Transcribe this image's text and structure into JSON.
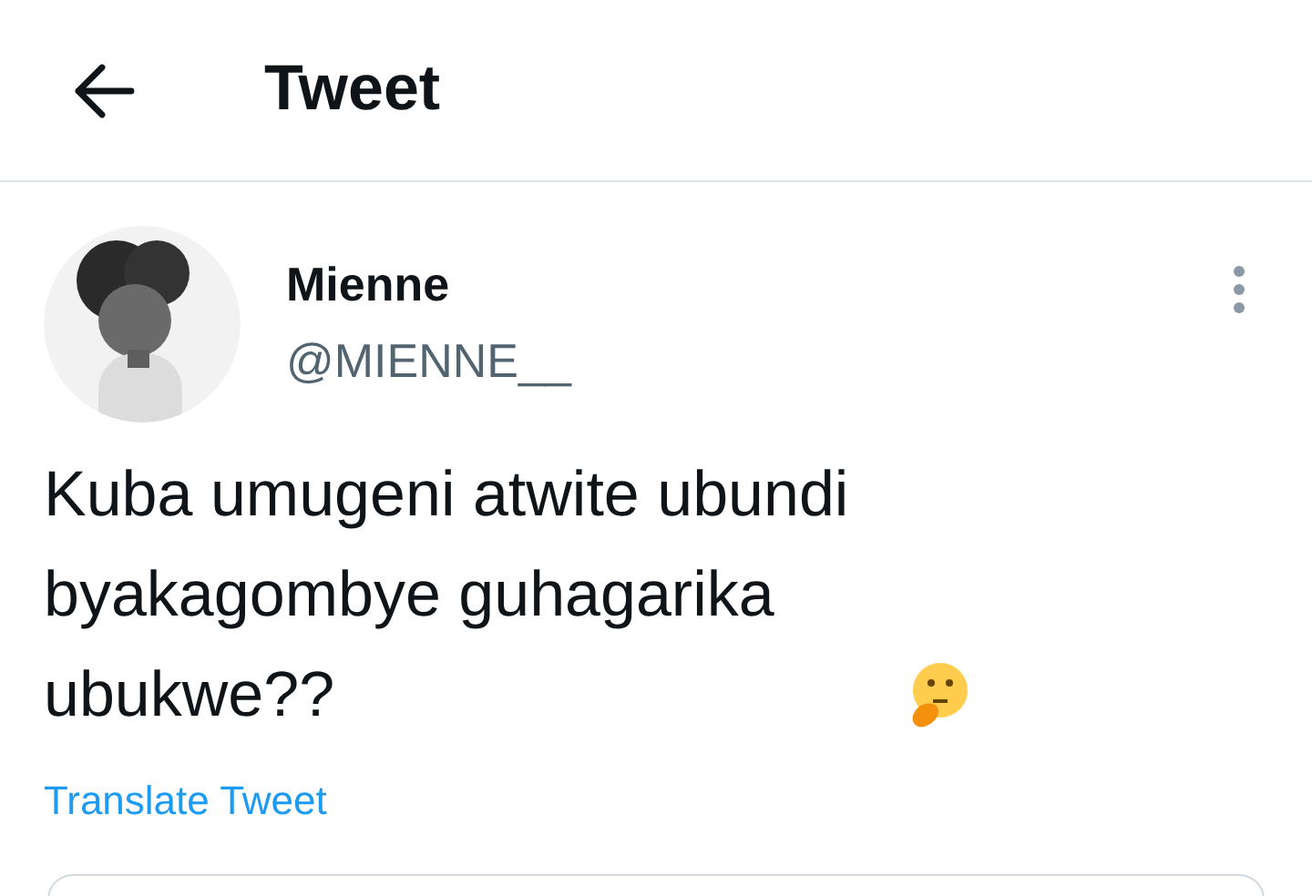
{
  "header": {
    "title": "Tweet"
  },
  "tweet": {
    "name": "Mienne",
    "handle": "@MIENNE__",
    "text": "Kuba umugeni atwite ubundi byakagombye guhagarika ubukwe??",
    "translate": "Translate Tweet"
  }
}
